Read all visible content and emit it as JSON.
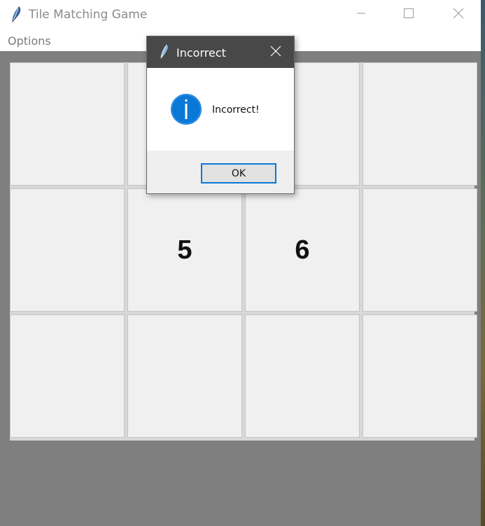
{
  "window": {
    "title": "Tile Matching Game",
    "menu": [
      "Options"
    ]
  },
  "board": {
    "rows": 3,
    "cols": 4,
    "tiles": [
      {
        "label": ""
      },
      {
        "label": ""
      },
      {
        "label": ""
      },
      {
        "label": ""
      },
      {
        "label": ""
      },
      {
        "label": "5"
      },
      {
        "label": "6"
      },
      {
        "label": ""
      },
      {
        "label": ""
      },
      {
        "label": ""
      },
      {
        "label": ""
      },
      {
        "label": ""
      }
    ]
  },
  "dialog": {
    "title": "Incorrect",
    "icon": "info-icon",
    "message": "Incorrect!",
    "ok_label": "OK"
  },
  "colors": {
    "board_bg": "#7f7f7f",
    "tile_bg": "#f0f0f0",
    "dialog_titlebar": "#484848",
    "accent": "#0a78d7",
    "info_icon": "#0a78d7"
  }
}
